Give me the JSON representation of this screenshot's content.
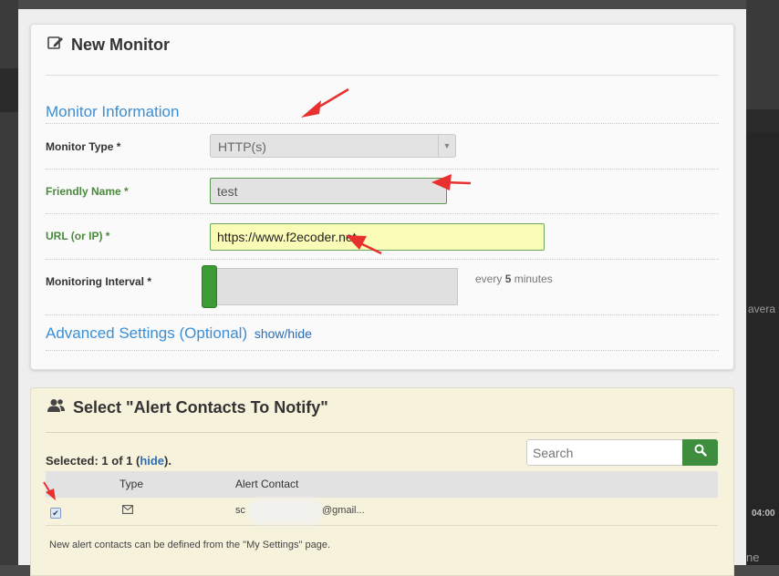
{
  "background": {
    "right_text": "avera",
    "right_time": "04:00",
    "right_bottom": "ne"
  },
  "new_monitor": {
    "title": "New Monitor",
    "icon": "edit-icon",
    "section_title": "Monitor Information",
    "monitor_type_label": "Monitor Type *",
    "monitor_type_value": "HTTP(s)",
    "friendly_name_label": "Friendly Name *",
    "friendly_name_value": "test",
    "url_label": "URL (or IP) *",
    "url_value": "https://www.f2ecoder.net",
    "interval_label": "Monitoring Interval *",
    "interval_prefix": "every",
    "interval_number": "5",
    "interval_unit": "minutes",
    "interval_level": 0.0,
    "advanced_label": "Advanced Settings (Optional)",
    "advanced_link": "show/hide"
  },
  "alert_contacts": {
    "title": "Select \"Alert Contacts To Notify\"",
    "icon": "users-icon",
    "selected_prefix": "Selected: 1 of 1 (",
    "selected_link": "hide",
    "selected_suffix": ").",
    "search_placeholder": "Search",
    "columns": [
      "Type",
      "Alert Contact"
    ],
    "rows": [
      {
        "checked": true,
        "type_icon": "envelope-icon",
        "contact_start": "sc",
        "contact_end": "@gmail..."
      }
    ],
    "note": "New alert contacts can be defined from the \"My Settings\" page."
  },
  "colors": {
    "accent_blue": "#3a8fd6",
    "success_green": "#3d9b35",
    "annotation_red": "#e8312f"
  }
}
